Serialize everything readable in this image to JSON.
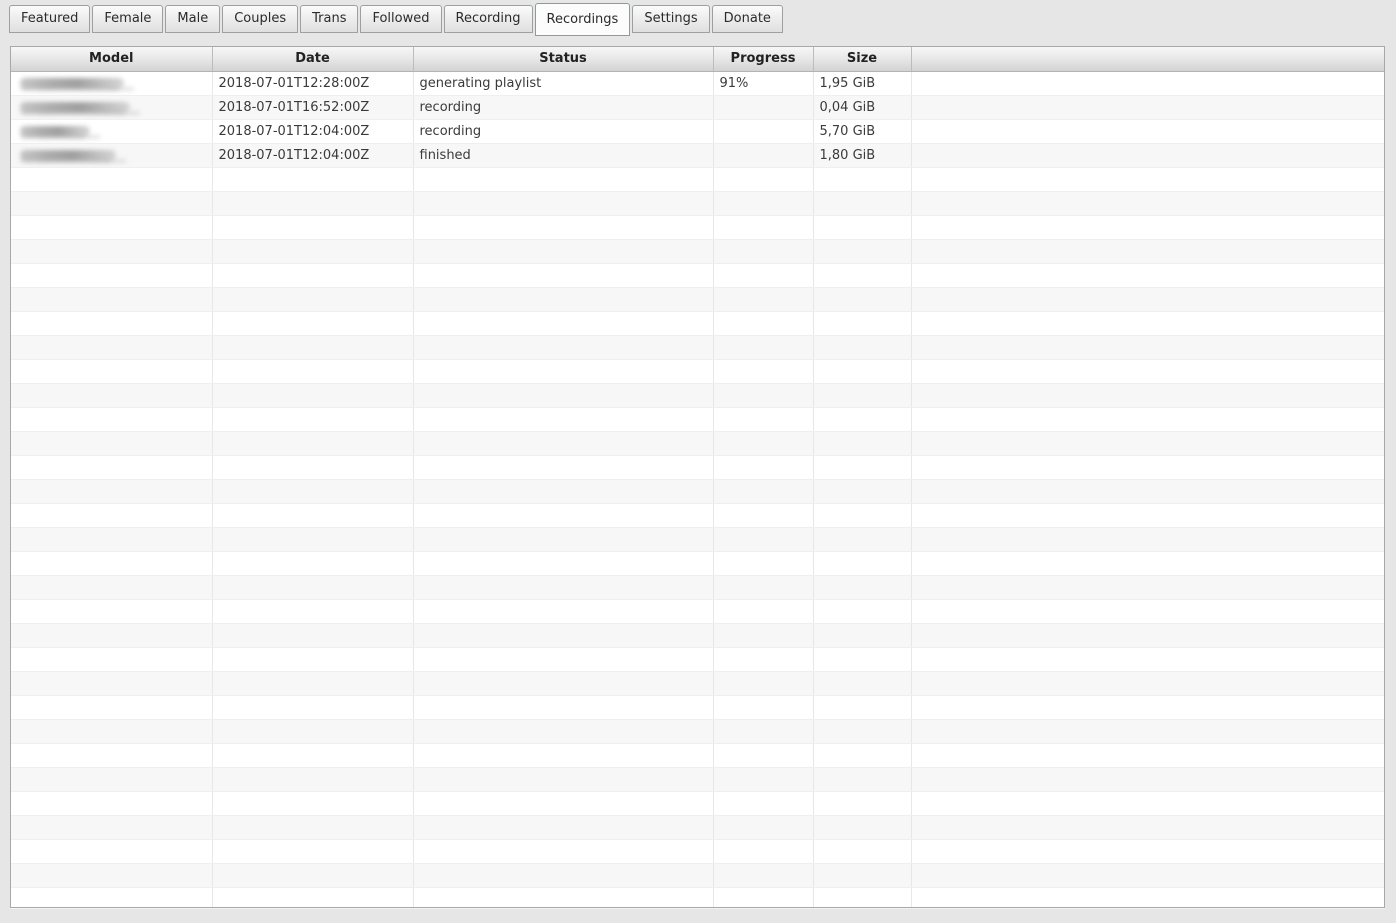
{
  "tabs": {
    "items": [
      {
        "label": "Featured",
        "selected": false
      },
      {
        "label": "Female",
        "selected": false
      },
      {
        "label": "Male",
        "selected": false
      },
      {
        "label": "Couples",
        "selected": false
      },
      {
        "label": "Trans",
        "selected": false
      },
      {
        "label": "Followed",
        "selected": false
      },
      {
        "label": "Recording",
        "selected": false
      },
      {
        "label": "Recordings",
        "selected": true
      },
      {
        "label": "Settings",
        "selected": false
      },
      {
        "label": "Donate",
        "selected": false
      }
    ]
  },
  "table": {
    "columns": [
      {
        "label": "Model"
      },
      {
        "label": "Date"
      },
      {
        "label": "Status"
      },
      {
        "label": "Progress"
      },
      {
        "label": "Size"
      },
      {
        "label": ""
      }
    ],
    "rows": [
      {
        "model": "[redacted]",
        "model_redacted_width": 104,
        "date": "2018-07-01T12:28:00Z",
        "status": "generating playlist",
        "progress": "91%",
        "size": "1,95 GiB"
      },
      {
        "model": "[redacted]",
        "model_redacted_width": 110,
        "date": "2018-07-01T16:52:00Z",
        "status": "recording",
        "progress": "",
        "size": "0,04 GiB"
      },
      {
        "model": "[redacted]",
        "model_redacted_width": 70,
        "date": "2018-07-01T12:04:00Z",
        "status": "recording",
        "progress": "",
        "size": "5,70 GiB"
      },
      {
        "model": "[redacted]",
        "model_redacted_width": 96,
        "date": "2018-07-01T12:04:00Z",
        "status": "finished",
        "progress": "",
        "size": "1,80 GiB"
      }
    ],
    "empty_rows": 31
  },
  "colors": {
    "selected_tab_border": "#62a8c9",
    "page_background": "#e6e6e6",
    "row_stripe": "#f7f7f7",
    "header_gradient_top": "#f7f7f7",
    "header_gradient_bottom": "#d3d3d3"
  }
}
